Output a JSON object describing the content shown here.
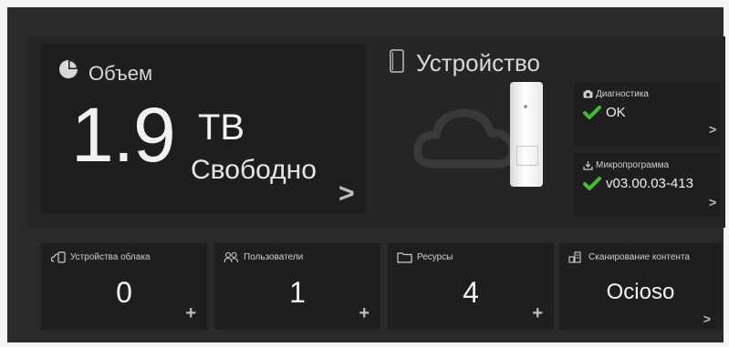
{
  "capacity": {
    "title": "Объем",
    "icon": "pie-chart-icon",
    "value": "1.9",
    "unit": "TB",
    "free_label": "Свободно",
    "more": ">"
  },
  "device": {
    "title": "Устройство",
    "icon": "device-outline-icon",
    "illustration": "cloud-with-drive"
  },
  "status": {
    "diagnostics": {
      "label": "Диагностика",
      "icon": "camera-icon",
      "value": "OK",
      "ok_icon": "checkmark-icon",
      "more": ">"
    },
    "firmware": {
      "label": "Микропрограмма",
      "icon": "download-icon",
      "value": "v03.00.03-413",
      "ok_icon": "checkmark-icon",
      "more": ">"
    }
  },
  "tiles": [
    {
      "label": "Устройства облака",
      "icon": "cloud-devices-icon",
      "value": "0",
      "action": "+"
    },
    {
      "label": "Пользователи",
      "icon": "users-icon",
      "value": "1",
      "action": "+"
    },
    {
      "label": "Ресурсы",
      "icon": "folder-icon",
      "value": "4",
      "action": "+"
    },
    {
      "label": "Сканирование контента",
      "icon": "scan-content-icon",
      "value": "Ocioso",
      "action": ">"
    }
  ],
  "colors": {
    "background": "#2b2a2a",
    "panel": "#1f1e1e",
    "accent_check": "#3fbf2f",
    "text": "#f2f2f2"
  }
}
